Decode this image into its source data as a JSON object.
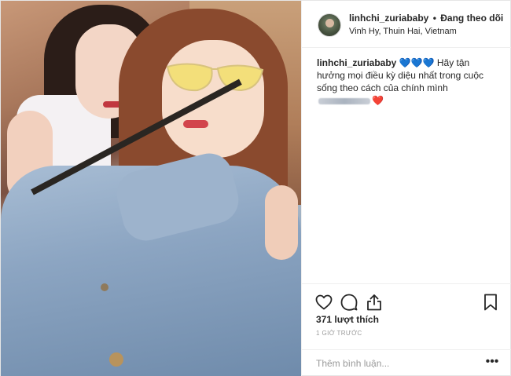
{
  "post": {
    "username": "linhchi_zuriababy",
    "separator": "•",
    "follow_status": "Đang theo dõi",
    "location": "Vinh Hy, Thuin Hai, Vietnam",
    "caption": {
      "username": "linhchi_zuriababy",
      "emoji_prefix": "💙💙💙",
      "text": "Hãy tận hưởng mọi điều kỳ diệu nhất trong cuộc sống theo cách của chính mình",
      "emoji_suffix": "❤️"
    },
    "likes_text": "371 lượt thích",
    "time_ago": "1 GIỜ TRƯỚC",
    "comment_placeholder": "Thêm bình luận...",
    "more_label": "•••"
  },
  "icons": {
    "like": "heart-outline-icon",
    "comment": "speech-bubble-icon",
    "share": "share-upload-icon",
    "save": "bookmark-icon",
    "more": "ellipsis-icon"
  },
  "colors": {
    "text": "#262626",
    "muted": "#999999",
    "border": "#efefef",
    "blue_heart": "#2f86e8",
    "red_heart": "#e0282f"
  }
}
